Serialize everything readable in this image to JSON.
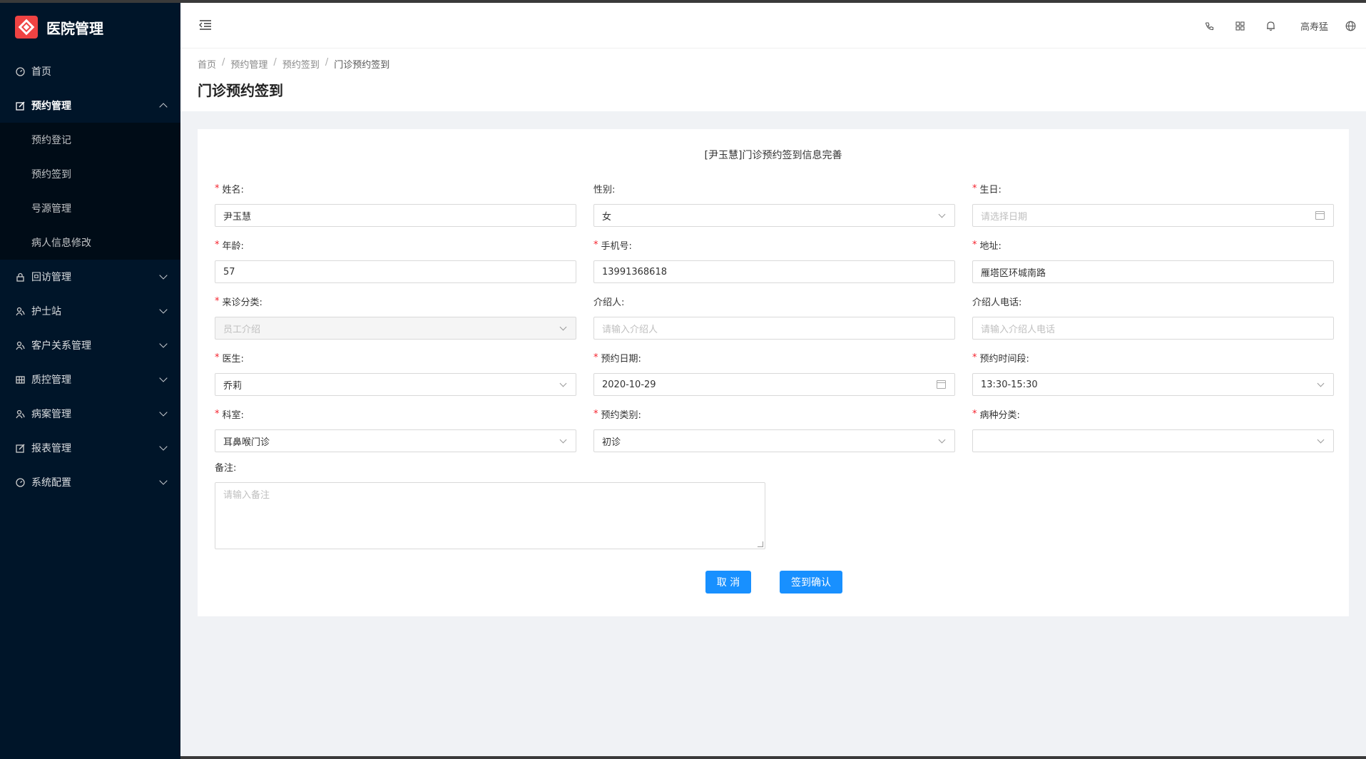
{
  "app": {
    "title": "医院管理"
  },
  "sidebar": {
    "items": [
      {
        "label": "首页",
        "icon": "dashboard-icon"
      },
      {
        "label": "预约管理",
        "icon": "edit-icon"
      },
      {
        "label": "回访管理",
        "icon": "lock-icon"
      },
      {
        "label": "护士站",
        "icon": "user-icon"
      },
      {
        "label": "客户关系管理",
        "icon": "user-icon"
      },
      {
        "label": "质控管理",
        "icon": "table-icon"
      },
      {
        "label": "病案管理",
        "icon": "user-icon"
      },
      {
        "label": "报表管理",
        "icon": "edit-icon"
      },
      {
        "label": "系统配置",
        "icon": "dashboard-icon"
      }
    ],
    "submenu": [
      "预约登记",
      "预约签到",
      "号源管理",
      "病人信息修改"
    ]
  },
  "header": {
    "username": "高寿猛"
  },
  "breadcrumb": [
    "首页",
    "预约管理",
    "预约签到",
    "门诊预约签到"
  ],
  "page": {
    "title": "门诊预约签到"
  },
  "form": {
    "title": "[尹玉慧]门诊预约签到信息完善",
    "fields": [
      {
        "label": "姓名:",
        "required": true,
        "value": "尹玉慧",
        "placeholder": ""
      },
      {
        "label": "性别:",
        "required": false,
        "value": "女",
        "placeholder": ""
      },
      {
        "label": "生日:",
        "required": true,
        "value": "",
        "placeholder": "请选择日期"
      },
      {
        "label": "年龄:",
        "required": true,
        "value": "57",
        "placeholder": ""
      },
      {
        "label": "手机号:",
        "required": true,
        "value": "13991368618",
        "placeholder": ""
      },
      {
        "label": "地址:",
        "required": true,
        "value": "雁塔区环城南路",
        "placeholder": ""
      },
      {
        "label": "来诊分类:",
        "required": true,
        "value": "员工介绍",
        "placeholder": ""
      },
      {
        "label": "介绍人:",
        "required": false,
        "value": "",
        "placeholder": "请输入介绍人"
      },
      {
        "label": "介绍人电话:",
        "required": false,
        "value": "",
        "placeholder": "请输入介绍人电话"
      },
      {
        "label": "医生:",
        "required": true,
        "value": "乔莉",
        "placeholder": ""
      },
      {
        "label": "预约日期:",
        "required": true,
        "value": "2020-10-29",
        "placeholder": ""
      },
      {
        "label": "预约时间段:",
        "required": true,
        "value": "13:30-15:30",
        "placeholder": ""
      },
      {
        "label": "科室:",
        "required": true,
        "value": "耳鼻喉门诊",
        "placeholder": ""
      },
      {
        "label": "预约类别:",
        "required": true,
        "value": "初诊",
        "placeholder": ""
      },
      {
        "label": "病种分类:",
        "required": true,
        "value": "",
        "placeholder": ""
      }
    ],
    "remark": {
      "label": "备注:",
      "placeholder": "请输入备注"
    },
    "cancel_label": "取 消",
    "confirm_label": "签到确认"
  },
  "colors": {
    "sidebar_bg": "#001529",
    "primary": "#1890ff",
    "logo": "#ef4343",
    "required": "#f5222d"
  }
}
